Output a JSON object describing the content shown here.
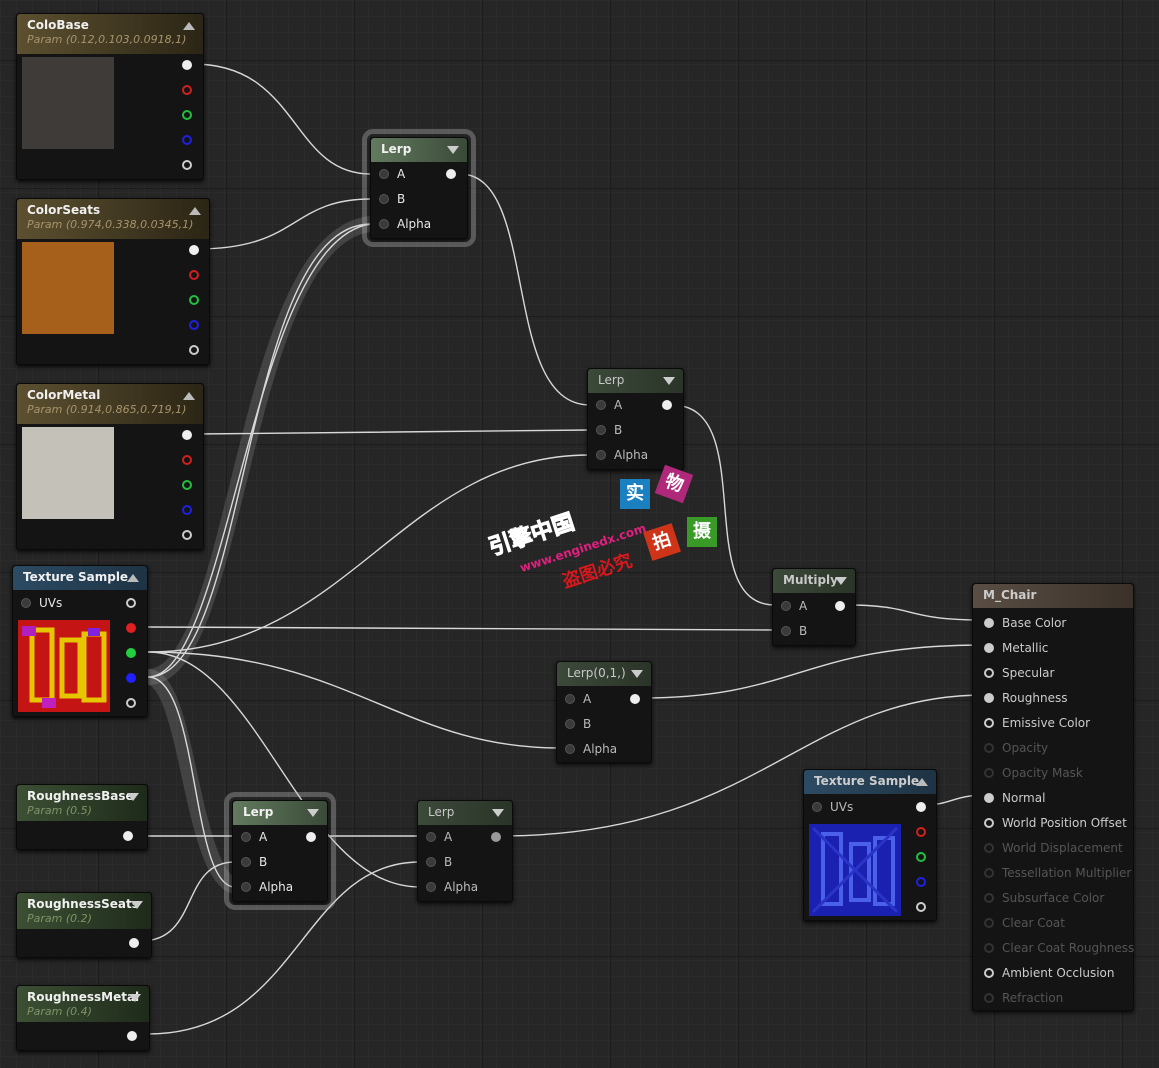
{
  "nodes": {
    "colo_base": {
      "title": "ColoBase",
      "subtitle": "Param (0.12,0.103,0.0918,1)",
      "color": "#3f3b39"
    },
    "color_seats": {
      "title": "ColorSeats",
      "subtitle": "Param (0.974,0.338,0.0345,1)",
      "color": "#a7601c"
    },
    "color_metal": {
      "title": "ColorMetal",
      "subtitle": "Param (0.914,0.865,0.719,1)",
      "color": "#c4c1b9"
    },
    "texture_sample_1": {
      "title": "Texture Sample",
      "uvs": "UVs"
    },
    "roughness_base": {
      "title": "RoughnessBase",
      "subtitle": "Param (0.5)"
    },
    "roughness_seats": {
      "title": "RoughnessSeats",
      "subtitle": "Param (0.2)"
    },
    "roughness_metal": {
      "title": "RoughnessMetal",
      "subtitle": "Param (0.4)"
    },
    "lerp_1": {
      "title": "Lerp",
      "a": "A",
      "b": "B",
      "alpha": "Alpha"
    },
    "lerp_2": {
      "title": "Lerp",
      "a": "A",
      "b": "B",
      "alpha": "Alpha"
    },
    "lerp_3": {
      "title": "Lerp(0,1,)",
      "a": "A",
      "b": "B",
      "alpha": "Alpha"
    },
    "lerp_4": {
      "title": "Lerp",
      "a": "A",
      "b": "B",
      "alpha": "Alpha"
    },
    "lerp_5": {
      "title": "Lerp",
      "a": "A",
      "b": "B",
      "alpha": "Alpha"
    },
    "multiply": {
      "title": "Multiply",
      "a": "A",
      "b": "B"
    },
    "texture_sample_2": {
      "title": "Texture Sample",
      "uvs": "UVs"
    },
    "material": {
      "title": "M_Chair",
      "inputs": [
        "Base Color",
        "Metallic",
        "Specular",
        "Roughness",
        "Emissive Color",
        "Opacity",
        "Opacity Mask",
        "Normal",
        "World Position Offset",
        "World Displacement",
        "Tessellation Multiplier",
        "Subsurface Color",
        "Clear Coat",
        "Clear Coat Roughness",
        "Ambient Occlusion",
        "Refraction"
      ]
    }
  },
  "watermark": {
    "brand": "引擎中国",
    "url": "www.enginedx.com",
    "notice": "盗图必究",
    "c1": "实",
    "c2": "物",
    "c3": "拍",
    "c4": "摄"
  }
}
